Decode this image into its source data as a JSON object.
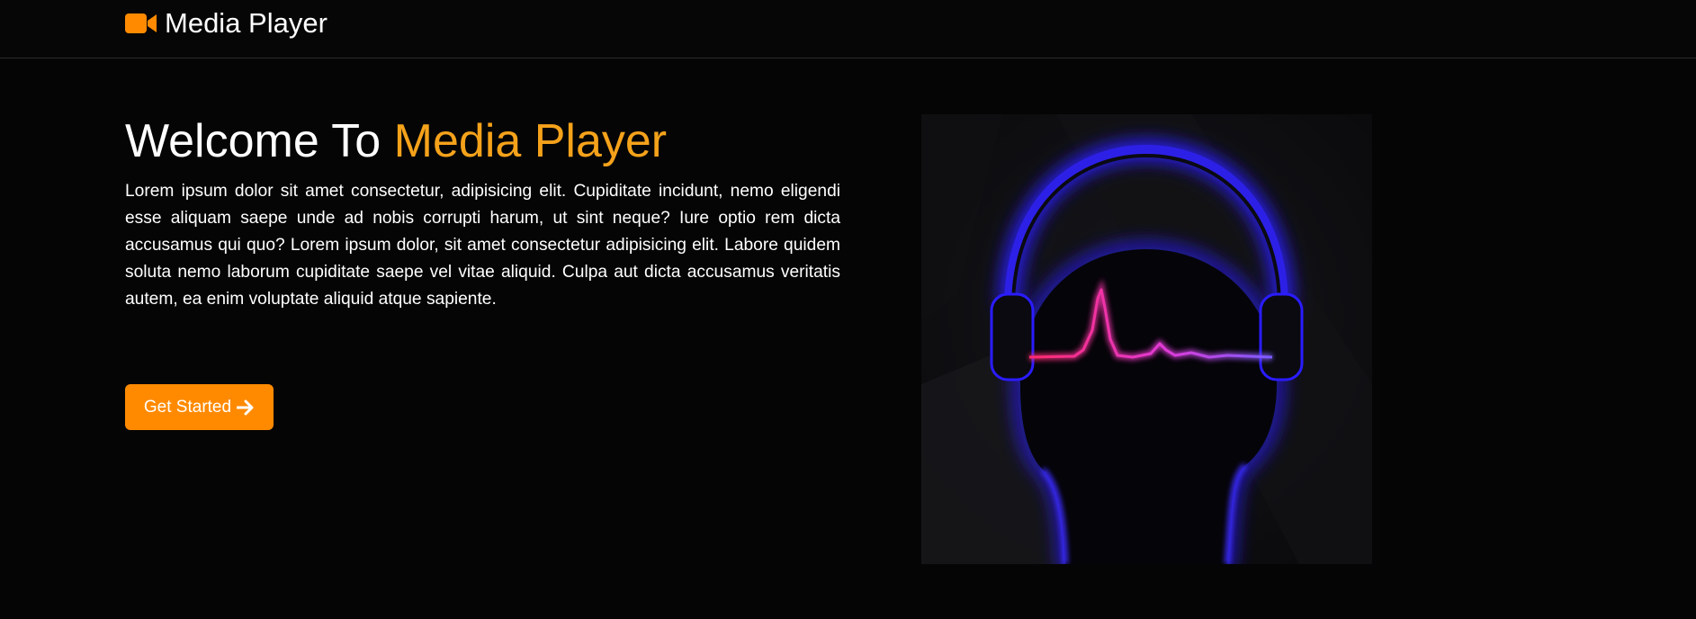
{
  "nav": {
    "brand_label": "Media Player",
    "brand_icon": "video-camera-icon",
    "accent_color": "#ff8a00"
  },
  "hero": {
    "title_prefix": "Welcome To",
    "title_accent": "Media Player",
    "title_accent_color": "#f5a21b",
    "description": "Lorem ipsum dolor sit amet consectetur, adipisicing elit. Cupiditate incidunt, nemo eligendi esse aliquam saepe unde ad nobis corrupti harum, ut sint neque? Iure optio rem dicta accusamus qui quo? Lorem ipsum dolor, sit amet consectetur adipisicing elit. Labore quidem soluta nemo laborum cupiditate saepe vel vitae aliquid. Culpa aut dicta accusamus veritatis autem, ea enim voluptate aliquid atque sapiente.",
    "cta_label": "Get Started",
    "cta_icon": "arrow-right-icon",
    "cta_color": "#ff8a00",
    "image_icon": "headphones-heartbeat-illustration"
  }
}
